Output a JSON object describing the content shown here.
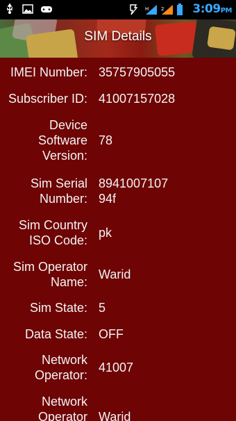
{
  "status_bar": {
    "time": "3:09",
    "ampm": "PM",
    "left_icons": [
      "usb-icon",
      "image-icon",
      "gamepad-icon"
    ],
    "right_icons": [
      "nfc-icon",
      "signal-icon",
      "signal-icon",
      "battery-icon"
    ]
  },
  "header": {
    "title": "SIM Details"
  },
  "details": [
    {
      "label": "IMEI Number:",
      "value": "35757905055"
    },
    {
      "label": "Subscriber ID:",
      "value": "41007157028"
    },
    {
      "label": "Device Software Version:",
      "value": "78"
    },
    {
      "label": "Sim Serial Number:",
      "value": "8941007107 94f"
    },
    {
      "label": "Sim Country ISO Code:",
      "value": "pk"
    },
    {
      "label": "Sim Operator Name:",
      "value": "Warid"
    },
    {
      "label": "Sim State:",
      "value": "5"
    },
    {
      "label": "Data State:",
      "value": "OFF"
    },
    {
      "label": "Network Operator:",
      "value": "41007"
    },
    {
      "label": "Network Operator Name:",
      "value": "Warid"
    }
  ],
  "colors": {
    "background": "#6e0404",
    "status_time": "#39a8ff"
  }
}
